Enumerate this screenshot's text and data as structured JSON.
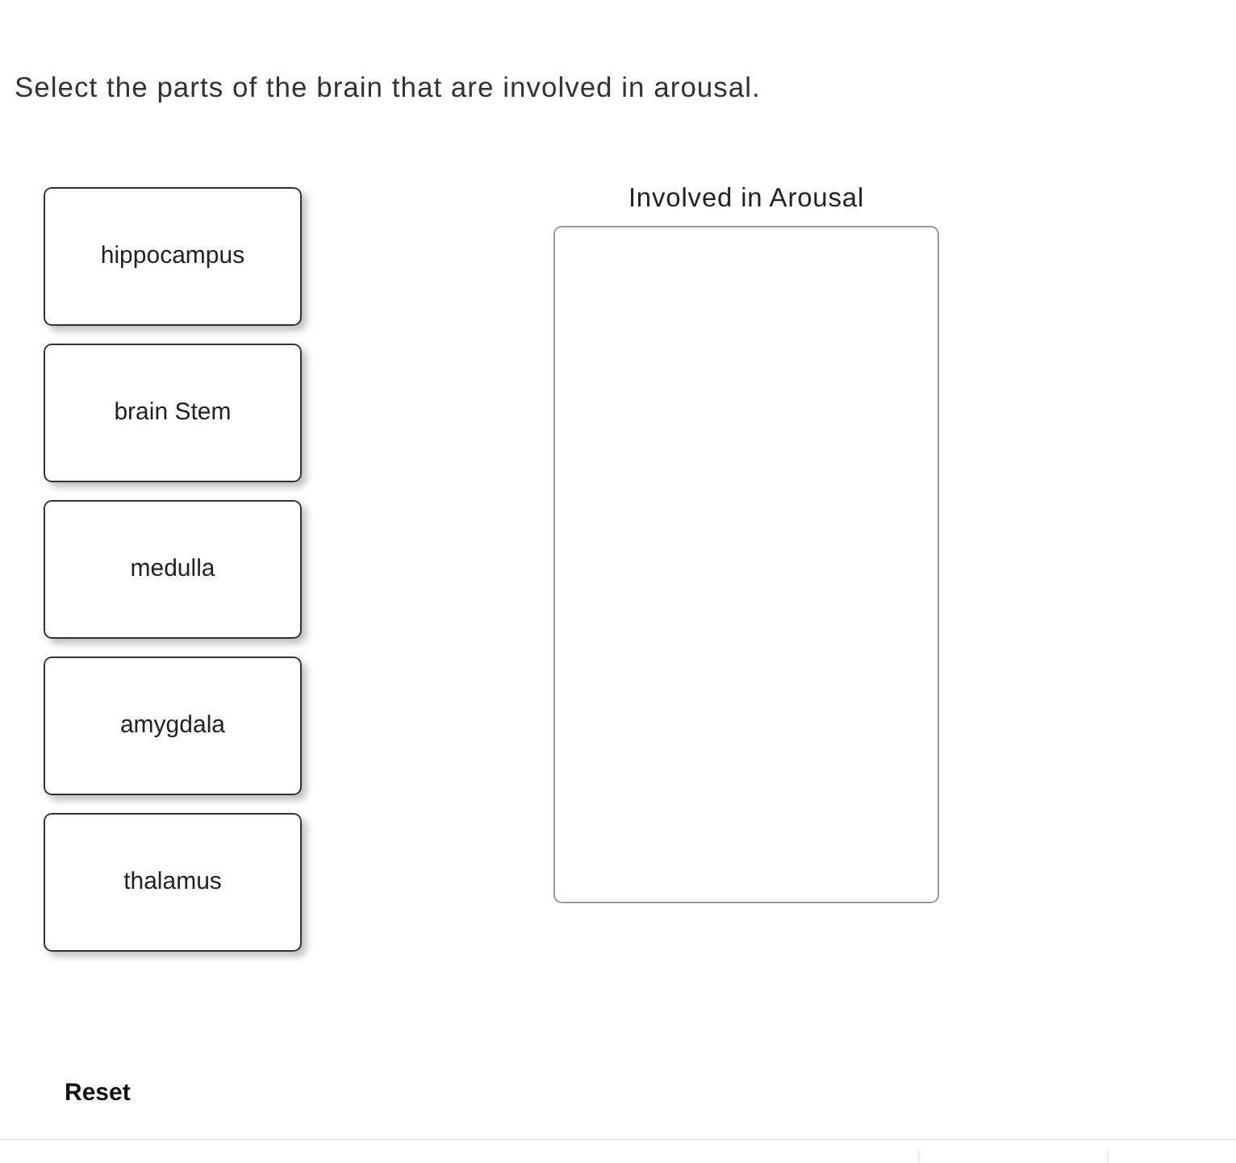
{
  "prompt": "Select the parts of the brain that are involved in arousal.",
  "choices": [
    {
      "label": "hippocampus"
    },
    {
      "label": "brain Stem"
    },
    {
      "label": "medulla"
    },
    {
      "label": "amygdala"
    },
    {
      "label": "thalamus"
    }
  ],
  "drop_zone": {
    "title": "Involved in Arousal"
  },
  "reset_button": {
    "label": "Reset"
  }
}
